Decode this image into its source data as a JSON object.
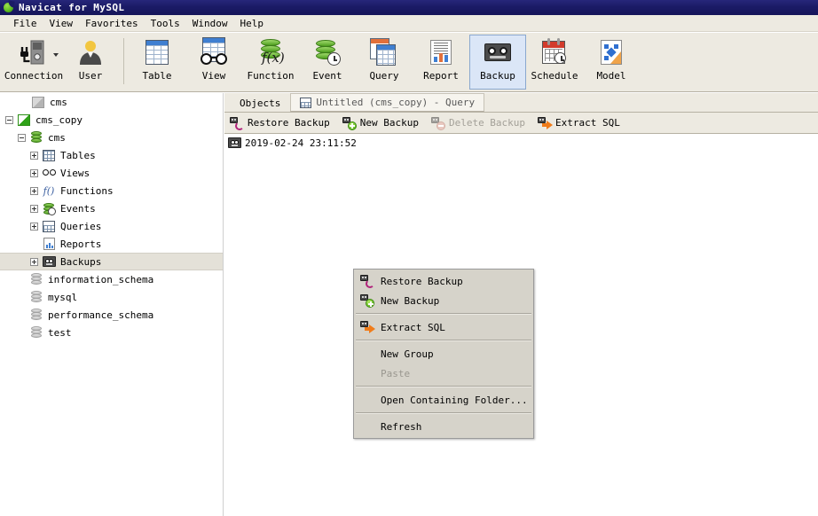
{
  "window": {
    "title": "Navicat for MySQL",
    "logo_icon": "navicat-logo-icon"
  },
  "menubar": {
    "items": [
      {
        "label": "File"
      },
      {
        "label": "View"
      },
      {
        "label": "Favorites"
      },
      {
        "label": "Tools"
      },
      {
        "label": "Window"
      },
      {
        "label": "Help"
      }
    ]
  },
  "toolbar": {
    "buttons": [
      {
        "label": "Connection",
        "icon": "connection-icon",
        "selected": false,
        "has_dropdown": true
      },
      {
        "label": "User",
        "icon": "user-icon",
        "selected": false
      },
      {
        "label": "Table",
        "icon": "table-icon",
        "selected": false
      },
      {
        "label": "View",
        "icon": "view-icon",
        "selected": false
      },
      {
        "label": "Function",
        "icon": "function-icon",
        "selected": false
      },
      {
        "label": "Event",
        "icon": "event-icon",
        "selected": false
      },
      {
        "label": "Query",
        "icon": "query-icon",
        "selected": false
      },
      {
        "label": "Report",
        "icon": "report-icon",
        "selected": false
      },
      {
        "label": "Backup",
        "icon": "backup-icon",
        "selected": true
      },
      {
        "label": "Schedule",
        "icon": "schedule-icon",
        "selected": false
      },
      {
        "label": "Model",
        "icon": "model-icon",
        "selected": false
      }
    ]
  },
  "sidebar": {
    "items": [
      {
        "label": "cms",
        "icon": "connection-offline-icon",
        "indent": 1,
        "expander": "none",
        "selected": false
      },
      {
        "label": "cms_copy",
        "icon": "connection-online-icon",
        "indent": 0,
        "expander": "minus",
        "selected": false
      },
      {
        "label": "cms",
        "icon": "database-icon",
        "indent": 1,
        "expander": "minus",
        "selected": false
      },
      {
        "label": "Tables",
        "icon": "tables-icon",
        "indent": 2,
        "expander": "plus",
        "selected": false
      },
      {
        "label": "Views",
        "icon": "views-icon",
        "indent": 2,
        "expander": "plus",
        "selected": false
      },
      {
        "label": "Functions",
        "icon": "functions-icon",
        "indent": 2,
        "expander": "plus",
        "selected": false
      },
      {
        "label": "Events",
        "icon": "events-icon",
        "indent": 2,
        "expander": "plus",
        "selected": false
      },
      {
        "label": "Queries",
        "icon": "queries-icon",
        "indent": 2,
        "expander": "plus",
        "selected": false
      },
      {
        "label": "Reports",
        "icon": "reports-icon",
        "indent": 2,
        "expander": "none",
        "selected": false
      },
      {
        "label": "Backups",
        "icon": "backups-icon",
        "indent": 2,
        "expander": "plus",
        "selected": true
      },
      {
        "label": "information_schema",
        "icon": "database-gray-icon",
        "indent": 1,
        "expander": "none",
        "selected": false
      },
      {
        "label": "mysql",
        "icon": "database-gray-icon",
        "indent": 1,
        "expander": "none",
        "selected": false
      },
      {
        "label": "performance_schema",
        "icon": "database-gray-icon",
        "indent": 1,
        "expander": "none",
        "selected": false
      },
      {
        "label": "test",
        "icon": "database-gray-icon",
        "indent": 1,
        "expander": "none",
        "selected": false
      }
    ]
  },
  "main": {
    "tabs": [
      {
        "label": "Objects",
        "active": true,
        "icon": null
      },
      {
        "label": "Untitled (cms_copy) - Query",
        "active": false,
        "icon": "query-tab-icon"
      }
    ],
    "actions": [
      {
        "label": "Restore Backup",
        "icon": "restore-backup-icon",
        "disabled": false
      },
      {
        "label": "New Backup",
        "icon": "new-backup-icon",
        "disabled": false
      },
      {
        "label": "Delete Backup",
        "icon": "delete-backup-icon",
        "disabled": true
      },
      {
        "label": "Extract SQL",
        "icon": "extract-sql-icon",
        "disabled": false
      }
    ],
    "backups": [
      {
        "name": "2019-02-24 23:11:52",
        "icon": "backup-file-icon"
      }
    ]
  },
  "context_menu": {
    "items": [
      {
        "label": "Restore Backup",
        "icon": "restore-backup-icon",
        "disabled": false,
        "separator_after": false
      },
      {
        "label": "New Backup",
        "icon": "new-backup-icon",
        "disabled": false,
        "separator_after": true
      },
      {
        "label": "Extract SQL",
        "icon": "extract-sql-icon",
        "disabled": false,
        "separator_after": true
      },
      {
        "label": "New Group",
        "icon": null,
        "disabled": false,
        "separator_after": false
      },
      {
        "label": "Paste",
        "icon": null,
        "disabled": true,
        "separator_after": true
      },
      {
        "label": "Open Containing Folder...",
        "icon": null,
        "disabled": false,
        "separator_after": true
      },
      {
        "label": "Refresh",
        "icon": null,
        "disabled": false,
        "separator_after": false
      }
    ]
  },
  "colors": {
    "titlebar": "#1b1b66",
    "chrome": "#edeae1",
    "selected_toolbar": "#dbe6f7",
    "selected_row": "#e4e1d8",
    "menu_bg": "#d6d3ca",
    "accent_green": "#4caa14",
    "accent_orange": "#f07c1a"
  }
}
